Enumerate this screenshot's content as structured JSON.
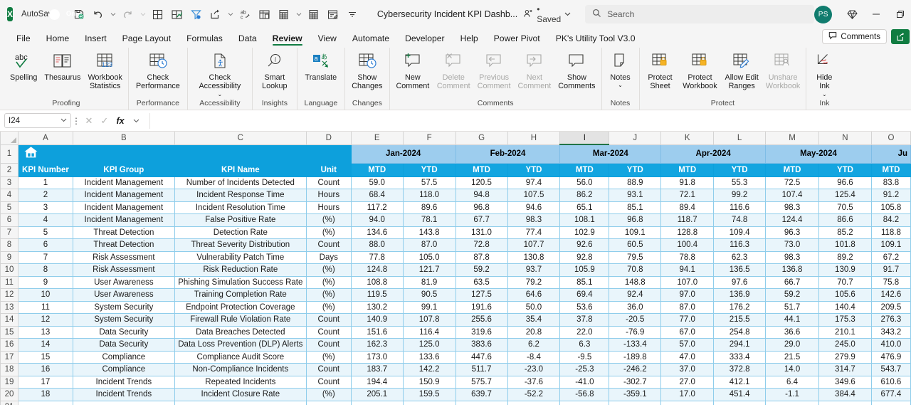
{
  "titlebar": {
    "app_logo": "excel-logo",
    "app_logo_letter": "X",
    "autosave_label": "AutoSave",
    "autosave_state": "On",
    "doc_title": "Cybersecurity Incident KPI Dashb...",
    "saved_status": "• Saved",
    "search_placeholder": "Search",
    "avatar_initials": "PS",
    "qat_items": [
      {
        "name": "save-icon"
      },
      {
        "name": "undo-icon"
      },
      {
        "name": "undo-caret-icon"
      },
      {
        "name": "redo-icon"
      },
      {
        "name": "redo-caret-icon"
      },
      {
        "name": "borders-icon"
      },
      {
        "name": "chart-icon"
      },
      {
        "name": "filter-icon"
      },
      {
        "name": "share-icon"
      },
      {
        "name": "share-caret-icon"
      },
      {
        "name": "spelling-icon"
      },
      {
        "name": "freeze-panes-icon"
      },
      {
        "name": "calculate-now-icon"
      },
      {
        "name": "calculate-caret-icon"
      },
      {
        "name": "calculate-sheet-icon"
      },
      {
        "name": "form-icon"
      },
      {
        "name": "customize-qat-icon"
      }
    ]
  },
  "tabs": [
    {
      "label": "File",
      "active": false
    },
    {
      "label": "Home",
      "active": false
    },
    {
      "label": "Insert",
      "active": false
    },
    {
      "label": "Page Layout",
      "active": false
    },
    {
      "label": "Formulas",
      "active": false
    },
    {
      "label": "Data",
      "active": false
    },
    {
      "label": "Review",
      "active": true
    },
    {
      "label": "View",
      "active": false
    },
    {
      "label": "Automate",
      "active": false
    },
    {
      "label": "Developer",
      "active": false
    },
    {
      "label": "Help",
      "active": false
    },
    {
      "label": "Power Pivot",
      "active": false
    },
    {
      "label": "PK's Utility Tool V3.0",
      "active": false
    }
  ],
  "tabs_right": {
    "comments_label": "Comments",
    "share_label": "share-icon"
  },
  "ribbon": {
    "groups": [
      {
        "label": "Proofing",
        "items": [
          {
            "label": "Spelling",
            "icon": "spelling-abc-icon",
            "disabled": false,
            "caret": false
          },
          {
            "label": "Thesaurus",
            "icon": "thesaurus-book-icon",
            "disabled": false,
            "caret": false
          },
          {
            "label": "Workbook\nStatistics",
            "icon": "workbook-statistics-icon",
            "disabled": false,
            "caret": false
          }
        ]
      },
      {
        "label": "Performance",
        "items": [
          {
            "label": "Check\nPerformance",
            "icon": "check-performance-icon",
            "disabled": false,
            "caret": false
          }
        ]
      },
      {
        "label": "Accessibility",
        "items": [
          {
            "label": "Check\nAccessibility",
            "icon": "check-accessibility-icon",
            "disabled": false,
            "caret": true
          }
        ]
      },
      {
        "label": "Insights",
        "items": [
          {
            "label": "Smart\nLookup",
            "icon": "smart-lookup-icon",
            "disabled": false,
            "caret": false
          }
        ]
      },
      {
        "label": "Language",
        "items": [
          {
            "label": "Translate",
            "icon": "translate-icon",
            "disabled": false,
            "caret": false
          }
        ]
      },
      {
        "label": "Changes",
        "items": [
          {
            "label": "Show\nChanges",
            "icon": "show-changes-icon",
            "disabled": false,
            "caret": false
          }
        ]
      },
      {
        "label": "Comments",
        "items": [
          {
            "label": "New\nComment",
            "icon": "new-comment-icon",
            "disabled": false,
            "caret": false
          },
          {
            "label": "Delete\nComment",
            "icon": "delete-comment-icon",
            "disabled": true,
            "caret": false
          },
          {
            "label": "Previous\nComment",
            "icon": "previous-comment-icon",
            "disabled": true,
            "caret": false
          },
          {
            "label": "Next\nComment",
            "icon": "next-comment-icon",
            "disabled": true,
            "caret": false
          },
          {
            "label": "Show\nComments",
            "icon": "show-comments-icon",
            "disabled": false,
            "caret": false
          }
        ]
      },
      {
        "label": "Notes",
        "items": [
          {
            "label": "Notes",
            "icon": "notes-icon",
            "disabled": false,
            "caret": true
          }
        ]
      },
      {
        "label": "Protect",
        "items": [
          {
            "label": "Protect\nSheet",
            "icon": "protect-sheet-icon",
            "disabled": false,
            "caret": false
          },
          {
            "label": "Protect\nWorkbook",
            "icon": "protect-workbook-icon",
            "disabled": false,
            "caret": false
          },
          {
            "label": "Allow Edit\nRanges",
            "icon": "allow-edit-ranges-icon",
            "disabled": false,
            "caret": false
          },
          {
            "label": "Unshare\nWorkbook",
            "icon": "unshare-workbook-icon",
            "disabled": true,
            "caret": false
          }
        ]
      },
      {
        "label": "Ink",
        "items": [
          {
            "label": "Hide\nInk",
            "icon": "hide-ink-icon",
            "disabled": false,
            "caret": true
          }
        ]
      }
    ]
  },
  "formula_bar": {
    "name_box_value": "I24",
    "formula_value": "",
    "cancel_icon": "cancel-icon",
    "enter_icon": "confirm-icon",
    "fx_label": "fx"
  },
  "sheet": {
    "columns": [
      "A",
      "B",
      "C",
      "D",
      "E",
      "F",
      "G",
      "H",
      "I",
      "J",
      "K",
      "L",
      "M",
      "N",
      "O"
    ],
    "selected_column": "I",
    "row_numbers": [
      "1",
      "2",
      "3",
      "4",
      "5",
      "6",
      "7",
      "8",
      "9",
      "10",
      "11",
      "12",
      "13",
      "14",
      "15",
      "16",
      "17",
      "18",
      "19",
      "20",
      "21"
    ],
    "banner_home_icon": "home-icon",
    "months": [
      "Jan-2024",
      "Feb-2024",
      "Mar-2024",
      "Apr-2024",
      "May-2024",
      "Ju"
    ],
    "headers": [
      "KPI Number",
      "KPI Group",
      "KPI Name",
      "Unit"
    ],
    "sub_headers": [
      "MTD",
      "YTD"
    ],
    "rows": [
      {
        "num": "1",
        "group": "Incident Management",
        "name": "Number of Incidents Detected",
        "unit": "Count",
        "vals": [
          "59.0",
          "57.5",
          "120.5",
          "97.4",
          "56.0",
          "88.9",
          "91.8",
          "55.3",
          "72.5",
          "96.6",
          "83.8"
        ]
      },
      {
        "num": "2",
        "group": "Incident Management",
        "name": "Incident Response Time",
        "unit": "Hours",
        "vals": [
          "68.4",
          "118.0",
          "94.8",
          "107.5",
          "86.2",
          "93.1",
          "72.1",
          "99.2",
          "107.4",
          "125.4",
          "91.2"
        ]
      },
      {
        "num": "3",
        "group": "Incident Management",
        "name": "Incident Resolution Time",
        "unit": "Hours",
        "vals": [
          "117.2",
          "89.6",
          "96.8",
          "94.6",
          "65.1",
          "85.1",
          "89.4",
          "116.6",
          "98.3",
          "70.5",
          "105.8"
        ]
      },
      {
        "num": "4",
        "group": "Incident Management",
        "name": "False Positive Rate",
        "unit": "(%)",
        "vals": [
          "94.0",
          "78.1",
          "67.7",
          "98.3",
          "108.1",
          "96.8",
          "118.7",
          "74.8",
          "124.4",
          "86.6",
          "84.2"
        ]
      },
      {
        "num": "5",
        "group": "Threat Detection",
        "name": "Detection Rate",
        "unit": "(%)",
        "vals": [
          "134.6",
          "143.8",
          "131.0",
          "77.4",
          "102.9",
          "109.1",
          "128.8",
          "109.4",
          "96.3",
          "85.2",
          "118.8"
        ]
      },
      {
        "num": "6",
        "group": "Threat Detection",
        "name": "Threat Severity Distribution",
        "unit": "Count",
        "vals": [
          "88.0",
          "87.0",
          "72.8",
          "107.7",
          "92.6",
          "60.5",
          "100.4",
          "116.3",
          "73.0",
          "101.8",
          "109.1"
        ]
      },
      {
        "num": "7",
        "group": "Risk Assessment",
        "name": "Vulnerability Patch Time",
        "unit": "Days",
        "vals": [
          "77.8",
          "105.0",
          "87.8",
          "130.8",
          "92.8",
          "79.5",
          "78.8",
          "62.3",
          "98.3",
          "89.2",
          "67.2"
        ]
      },
      {
        "num": "8",
        "group": "Risk Assessment",
        "name": "Risk Reduction Rate",
        "unit": "(%)",
        "vals": [
          "124.8",
          "121.7",
          "59.2",
          "93.7",
          "105.9",
          "70.8",
          "94.1",
          "136.5",
          "136.8",
          "130.9",
          "91.7"
        ]
      },
      {
        "num": "9",
        "group": "User Awareness",
        "name": "Phishing Simulation Success Rate",
        "unit": "(%)",
        "vals": [
          "108.8",
          "81.9",
          "63.5",
          "79.2",
          "85.1",
          "148.8",
          "107.0",
          "97.6",
          "66.7",
          "70.7",
          "75.8"
        ]
      },
      {
        "num": "10",
        "group": "User Awareness",
        "name": "Training Completion Rate",
        "unit": "(%)",
        "vals": [
          "119.5",
          "90.5",
          "127.5",
          "64.6",
          "69.4",
          "92.4",
          "97.0",
          "136.9",
          "59.2",
          "105.6",
          "142.6"
        ]
      },
      {
        "num": "11",
        "group": "System Security",
        "name": "Endpoint Protection Coverage",
        "unit": "(%)",
        "vals": [
          "130.2",
          "99.1",
          "191.6",
          "50.0",
          "53.6",
          "36.0",
          "87.0",
          "176.2",
          "51.7",
          "140.4",
          "209.5"
        ]
      },
      {
        "num": "12",
        "group": "System Security",
        "name": "Firewall Rule Violation Rate",
        "unit": "Count",
        "vals": [
          "140.9",
          "107.8",
          "255.6",
          "35.4",
          "37.8",
          "-20.5",
          "77.0",
          "215.5",
          "44.1",
          "175.3",
          "276.3"
        ]
      },
      {
        "num": "13",
        "group": "Data Security",
        "name": "Data Breaches Detected",
        "unit": "Count",
        "vals": [
          "151.6",
          "116.4",
          "319.6",
          "20.8",
          "22.0",
          "-76.9",
          "67.0",
          "254.8",
          "36.6",
          "210.1",
          "343.2"
        ]
      },
      {
        "num": "14",
        "group": "Data Security",
        "name": "Data Loss Prevention (DLP) Alerts",
        "unit": "Count",
        "vals": [
          "162.3",
          "125.0",
          "383.6",
          "6.2",
          "6.3",
          "-133.4",
          "57.0",
          "294.1",
          "29.0",
          "245.0",
          "410.0"
        ]
      },
      {
        "num": "15",
        "group": "Compliance",
        "name": "Compliance Audit Score",
        "unit": "(%)",
        "vals": [
          "173.0",
          "133.6",
          "447.6",
          "-8.4",
          "-9.5",
          "-189.8",
          "47.0",
          "333.4",
          "21.5",
          "279.9",
          "476.9"
        ]
      },
      {
        "num": "16",
        "group": "Compliance",
        "name": "Non-Compliance Incidents",
        "unit": "Count",
        "vals": [
          "183.7",
          "142.2",
          "511.7",
          "-23.0",
          "-25.3",
          "-246.2",
          "37.0",
          "372.8",
          "14.0",
          "314.7",
          "543.7"
        ]
      },
      {
        "num": "17",
        "group": "Incident Trends",
        "name": "Repeated Incidents",
        "unit": "Count",
        "vals": [
          "194.4",
          "150.9",
          "575.7",
          "-37.6",
          "-41.0",
          "-302.7",
          "27.0",
          "412.1",
          "6.4",
          "349.6",
          "610.6"
        ]
      },
      {
        "num": "18",
        "group": "Incident Trends",
        "name": "Incident Closure Rate",
        "unit": "(%)",
        "vals": [
          "205.1",
          "159.5",
          "639.7",
          "-52.2",
          "-56.8",
          "-359.1",
          "17.0",
          "451.4",
          "-1.1",
          "384.4",
          "677.4"
        ]
      }
    ]
  },
  "colors": {
    "accent_green": "#107c41",
    "header_blue": "#0da0dc",
    "month_blue": "#9dcdee",
    "band_blue": "#e9f5fb",
    "grid_line": "#8fcdeb"
  }
}
